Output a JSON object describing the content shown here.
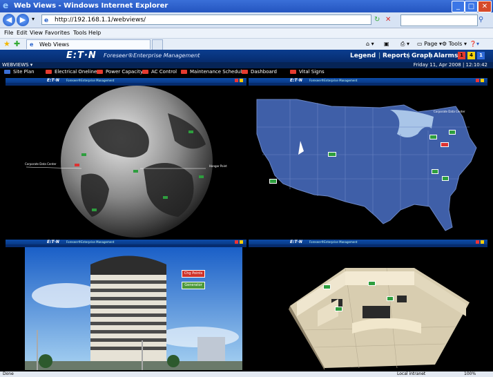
{
  "window": {
    "title": "Web Views - Windows Internet Explorer"
  },
  "addressbar": {
    "url": "http://192.168.1.1/webviews/"
  },
  "menu": [
    "File",
    "Edit",
    "View",
    "Favorites",
    "Tools",
    "Help"
  ],
  "tab": {
    "label": "Web Views"
  },
  "commandbar": {
    "page": "Page",
    "tools": "Tools"
  },
  "header": {
    "logo": "E:T·N",
    "product": "Foreseer®Enterprise Management",
    "nav": [
      "Legend",
      "Reports",
      "Graph",
      "Alarms"
    ],
    "alarm_counts": [
      "1",
      "4",
      "1"
    ],
    "colors": {
      "alarm_red": "#e53b2f",
      "alarm_yellow": "#f5d20c",
      "alarm_blue": "#2f6ad8"
    }
  },
  "subbar": {
    "left": "WEBVIEWS ▾",
    "right": "Friday 11, Apr 2008 | 12:10:42"
  },
  "views": [
    "Site Plan",
    "Electrical Oneline",
    "Power Capacity",
    "AC Control",
    "Maintenance Scheduler",
    "Dashboard",
    "Vital Signs"
  ],
  "globe": {
    "left_label": "Corporate Data Center",
    "right_label": "Hangar Point"
  },
  "map": {
    "label": "Corporate Data Center"
  },
  "building": {
    "btn_red": "Chg Points",
    "btn_green": "Generator"
  },
  "status": {
    "left": "Done",
    "right": "Local intranet",
    "zoom": "100%"
  }
}
